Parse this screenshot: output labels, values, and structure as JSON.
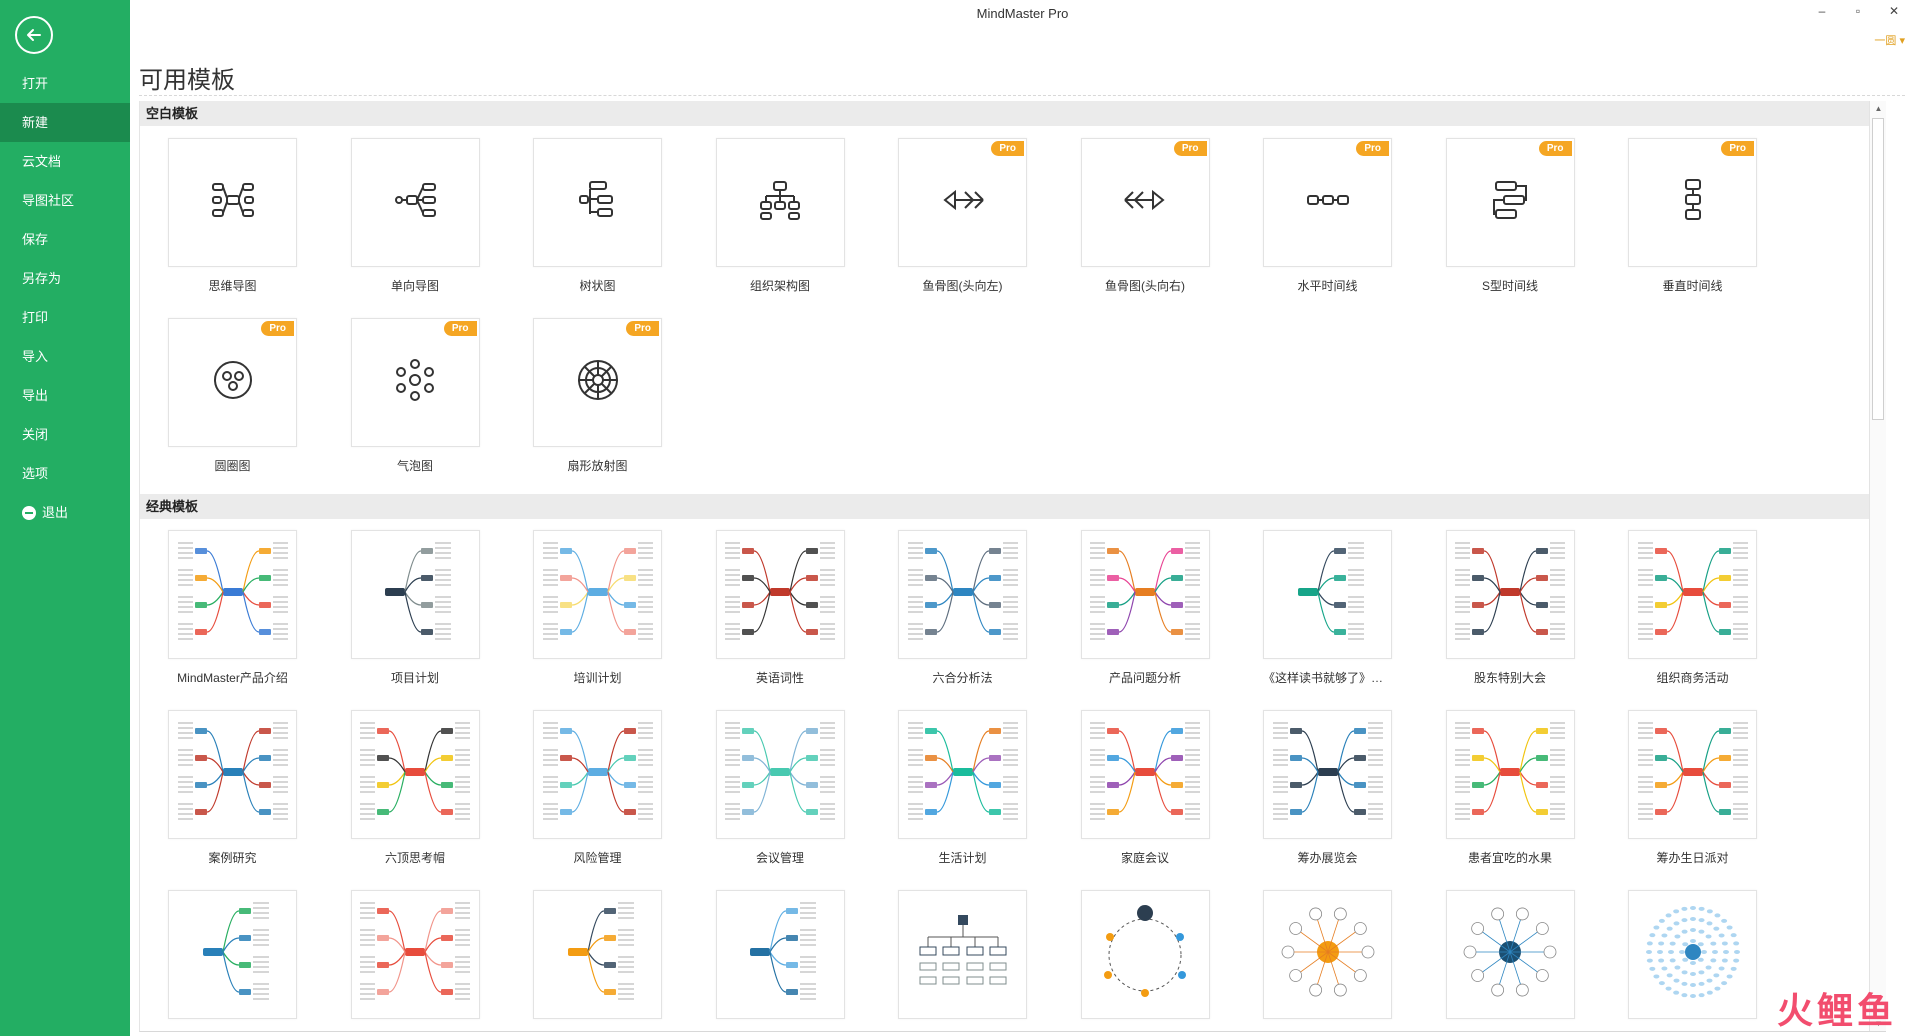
{
  "app": {
    "title": "MindMaster Pro",
    "user_label": "一圆 ▾"
  },
  "window_controls": {
    "minimize": "–",
    "restore": "▫",
    "close": "✕"
  },
  "sidebar": {
    "items": [
      {
        "label": "打开"
      },
      {
        "label": "新建",
        "active": true
      },
      {
        "label": "云文档"
      },
      {
        "label": "导图社区"
      },
      {
        "label": "保存"
      },
      {
        "label": "另存为"
      },
      {
        "label": "打印"
      },
      {
        "label": "导入"
      },
      {
        "label": "导出"
      },
      {
        "label": "关闭"
      },
      {
        "label": "选项"
      },
      {
        "label": "退出",
        "icon": "exit-icon"
      }
    ]
  },
  "page": {
    "title": "可用模板"
  },
  "sections": {
    "blank": {
      "title": "空白模板",
      "pro_badge": "Pro",
      "templates": [
        {
          "label": "思维导图",
          "icon": "mindmap",
          "pro": false
        },
        {
          "label": "单向导图",
          "icon": "right-map",
          "pro": false
        },
        {
          "label": "树状图",
          "icon": "tree",
          "pro": false
        },
        {
          "label": "组织架构图",
          "icon": "org",
          "pro": false
        },
        {
          "label": "鱼骨图(头向左)",
          "icon": "fish-left",
          "pro": true
        },
        {
          "label": "鱼骨图(头向右)",
          "icon": "fish-right",
          "pro": true
        },
        {
          "label": "水平时间线",
          "icon": "timeline-h",
          "pro": true
        },
        {
          "label": "S型时间线",
          "icon": "timeline-s",
          "pro": true
        },
        {
          "label": "垂直时间线",
          "icon": "timeline-v",
          "pro": true
        },
        {
          "label": "圆圈图",
          "icon": "circle",
          "pro": true
        },
        {
          "label": "气泡图",
          "icon": "bubble",
          "pro": true
        },
        {
          "label": "扇形放射图",
          "icon": "sector",
          "pro": true
        }
      ]
    },
    "classic": {
      "title": "经典模板",
      "templates": [
        {
          "label": "MindMaster产品介绍",
          "style": "mindmap",
          "colors": [
            "#3a7bd5",
            "#f39c12",
            "#27ae60",
            "#e74c3c"
          ]
        },
        {
          "label": "项目计划",
          "style": "logic",
          "colors": [
            "#2c3e50",
            "#7f8c8d"
          ]
        },
        {
          "label": "培训计划",
          "style": "mindmap",
          "colors": [
            "#5dade2",
            "#f1948a",
            "#f7dc6f"
          ]
        },
        {
          "label": "英语词性",
          "style": "mindmap",
          "colors": [
            "#c0392b",
            "#333333"
          ]
        },
        {
          "label": "六合分析法",
          "style": "mindmap",
          "colors": [
            "#2e86c1",
            "#5d6d7e"
          ]
        },
        {
          "label": "产品问题分析",
          "style": "mindmap",
          "colors": [
            "#e67e22",
            "#e84393",
            "#16a085",
            "#8e44ad"
          ]
        },
        {
          "label": "《这样读书就够了》思...",
          "style": "logic",
          "colors": [
            "#17a589",
            "#34495e"
          ]
        },
        {
          "label": "股东特别大会",
          "style": "mindmap",
          "colors": [
            "#c0392b",
            "#2c3e50"
          ]
        },
        {
          "label": "组织商务活动",
          "style": "mindmap",
          "colors": [
            "#e74c3c",
            "#16a085",
            "#f1c40f"
          ]
        },
        {
          "label": "案例研究",
          "style": "mindmap",
          "colors": [
            "#2980b9",
            "#c0392b"
          ]
        },
        {
          "label": "六顶思考帽",
          "style": "mindmap",
          "colors": [
            "#e74c3c",
            "#333333",
            "#f1c40f",
            "#27ae60"
          ]
        },
        {
          "label": "风险管理",
          "style": "mindmap",
          "colors": [
            "#5dade2",
            "#c0392b",
            "#48c9b0"
          ]
        },
        {
          "label": "会议管理",
          "style": "mindmap",
          "colors": [
            "#48c9b0",
            "#7fb3d5"
          ]
        },
        {
          "label": "生活计划",
          "style": "mindmap",
          "colors": [
            "#1abc9c",
            "#e67e22",
            "#9b59b6",
            "#3498db"
          ]
        },
        {
          "label": "家庭会议",
          "style": "mindmap",
          "colors": [
            "#e74c3c",
            "#3498db",
            "#8e44ad",
            "#f39c12"
          ]
        },
        {
          "label": "筹办展览会",
          "style": "mindmap",
          "colors": [
            "#2c3e50",
            "#2980b9"
          ]
        },
        {
          "label": "患者宜吃的水果",
          "style": "mindmap",
          "colors": [
            "#e74c3c",
            "#f1c40f",
            "#27ae60"
          ]
        },
        {
          "label": "筹办生日派对",
          "style": "mindmap",
          "colors": [
            "#e74c3c",
            "#16a085",
            "#f39c12"
          ]
        },
        {
          "label": "",
          "style": "logic",
          "colors": [
            "#2980b9",
            "#27ae60"
          ]
        },
        {
          "label": "",
          "style": "mindmap",
          "colors": [
            "#e74c3c",
            "#f1948a"
          ]
        },
        {
          "label": "",
          "style": "logic",
          "colors": [
            "#f39c12",
            "#34495e"
          ]
        },
        {
          "label": "",
          "style": "logic",
          "colors": [
            "#2471a3",
            "#5dade2"
          ]
        },
        {
          "label": "",
          "style": "org",
          "colors": [
            "#34495e",
            "#7f8c8d"
          ]
        },
        {
          "label": "",
          "style": "circle",
          "colors": [
            "#2c3e50",
            "#f39c12",
            "#3498db"
          ]
        },
        {
          "label": "",
          "style": "radial",
          "colors": [
            "#f39c12",
            "#e67e22"
          ]
        },
        {
          "label": "",
          "style": "radial",
          "colors": [
            "#1b4f72",
            "#2e86c1"
          ]
        },
        {
          "label": "",
          "style": "cloud",
          "colors": [
            "#2e86c1",
            "#aed6f1"
          ]
        }
      ]
    }
  },
  "watermark": "火鲤鱼"
}
